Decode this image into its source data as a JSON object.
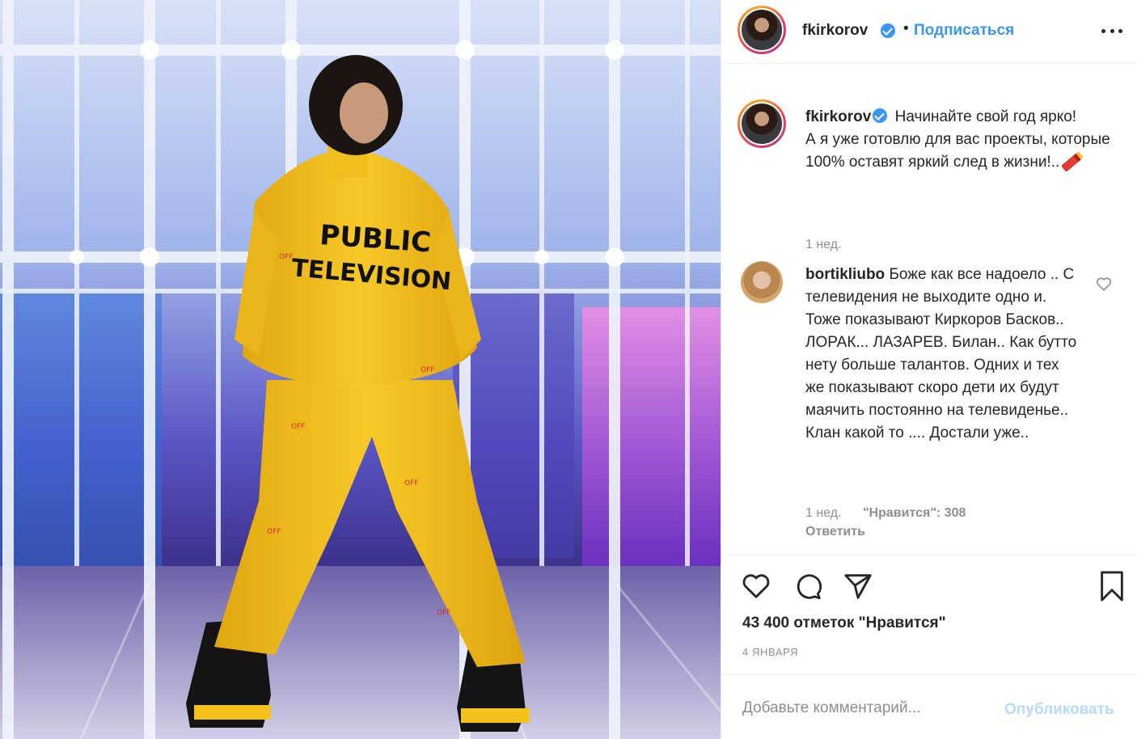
{
  "post": {
    "image_alt": "Man in yellow Off-White suit standing in glass atrium",
    "jacket_text": "PUBLIC TELEVISION",
    "suit_print": "Off-White",
    "colors": {
      "suit": "#f4c21b",
      "accent_blue": "#3897f0",
      "publish_disabled": "#b3dbff"
    }
  },
  "header": {
    "username": "fkirkorov",
    "separator": "•",
    "follow_label": "Подписаться",
    "more_icon": "more-horizontal-icon"
  },
  "caption": {
    "username": "fkirkorov",
    "lines": [
      "Начинайте свой год ярко!",
      "А я уже готовлю для вас проекты, которые 100% оставят яркий след в жизни!.."
    ],
    "emoji_icon": "firecracker-icon",
    "time": "1 нед."
  },
  "comment": {
    "username": "bortikliubo",
    "text": "Боже как все надоело .. С телевидения не выходите одно и. Тоже показывают Киркоров Басков.. ЛОРАК... ЛАЗАРЕВ. Билан.. Как бутто нету больше талантов. Одних и тех же показывают скоро дети их будут маячить постоянно на телевиденье.. Клан какой то .... Достали уже..",
    "time": "1 нед.",
    "likes": "\"Нравится\": 308",
    "reply_label": "Ответить"
  },
  "actions": {
    "likes_count": "43 400 отметок \"Нравится\"",
    "date": "4 января"
  },
  "add_comment": {
    "placeholder": "Добавьте комментарий...",
    "publish_label": "Опубликовать"
  }
}
